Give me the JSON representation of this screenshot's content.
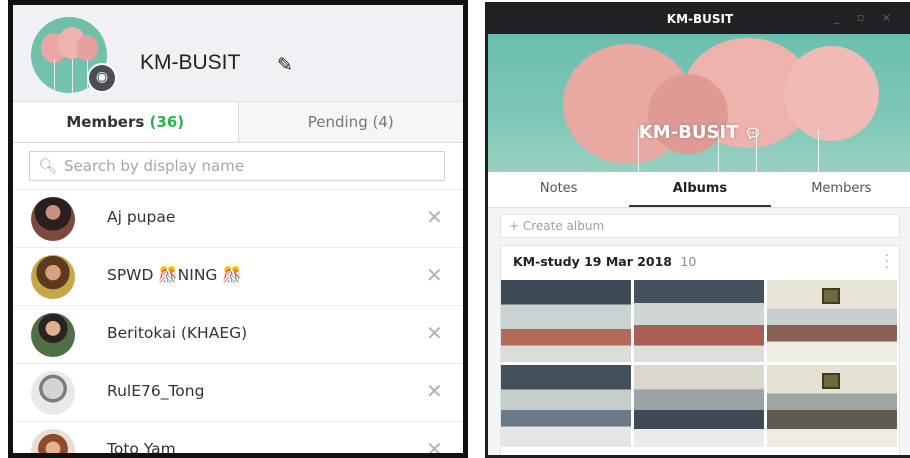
{
  "left_panel": {
    "group_name": "KM-BUSIT",
    "icons": {
      "edit": "pencil-icon",
      "camera": "camera-icon",
      "search": "search-icon",
      "remove": "close-icon"
    },
    "tabs": {
      "members_label": "Members",
      "members_count": "(36)",
      "pending_label": "Pending (4)"
    },
    "search_placeholder": "Search by display name",
    "members": [
      {
        "name": "Aj pupae"
      },
      {
        "name": "SPWD 🎊NING 🎊"
      },
      {
        "name": "Beritokai (KHAEG)"
      },
      {
        "name": "RulE76_Tong"
      },
      {
        "name": "Toto Yam"
      }
    ]
  },
  "right_panel": {
    "window_title": "KM-BUSIT",
    "window_controls": "_ ▫ ×",
    "cover_title": "KM-BUSIT",
    "tabs": [
      "Notes",
      "Albums",
      "Members"
    ],
    "active_tab": "Albums",
    "create_album_label": "+ Create album",
    "album": {
      "title": "KM-study 19 Mar 2018",
      "count": "10",
      "photo_count_visible": 6
    }
  },
  "colors": {
    "accent_green": "#2bb24a",
    "titlebar": "#1f2124",
    "cover": "#6cbfae"
  }
}
